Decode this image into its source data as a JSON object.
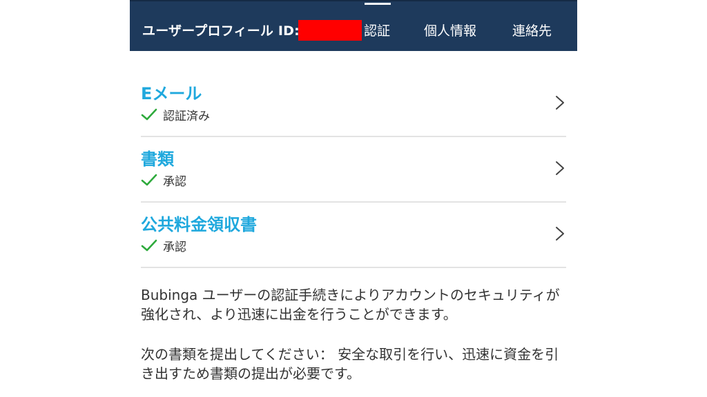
{
  "header": {
    "title": "ユーザープロフィール ID:",
    "tabs": [
      {
        "label": "認証",
        "active": true
      },
      {
        "label": "個人情報",
        "active": false
      },
      {
        "label": "連絡先",
        "active": false
      }
    ],
    "background_color": "#1e3a5c"
  },
  "verification_items": [
    {
      "title": "Eメール",
      "status": "認証済み",
      "status_icon": "check-icon"
    },
    {
      "title": "書類",
      "status": "承認",
      "status_icon": "check-icon"
    },
    {
      "title": "公共料金領収書",
      "status": "承認",
      "status_icon": "check-icon"
    }
  ],
  "accent_color": "#1fa8dd",
  "check_color": "#2eaa3c",
  "description": {
    "paragraph1": "Bubinga ユーザーの認証手続きによりアカウントのセキュリティが強化され、より迅速に出金を行うことができます。",
    "paragraph2": "次の書類を提出してください： 安全な取引を行い、迅速に資金を引き出すため書類の提出が必要です。"
  }
}
